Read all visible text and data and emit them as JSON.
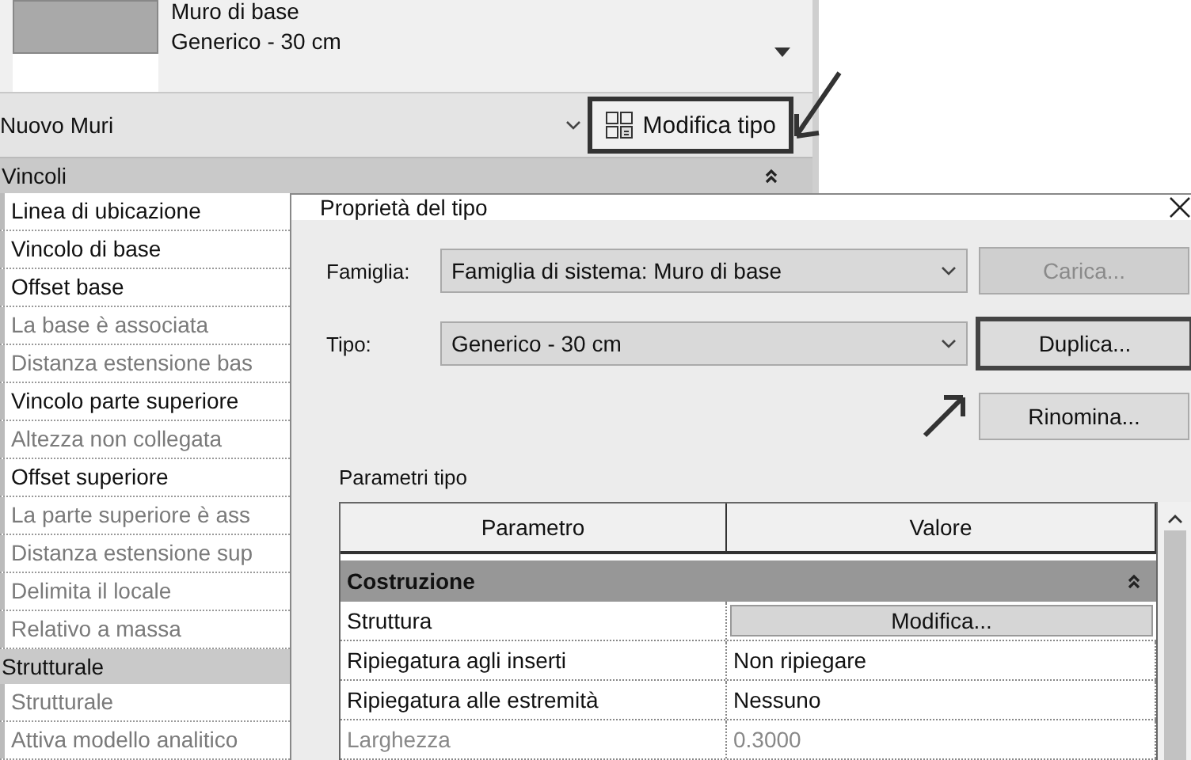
{
  "palette": {
    "type_selector": {
      "family": "Muro di base",
      "type": "Generico - 30 cm"
    },
    "instance_dropdown": "Nuovo Muri",
    "edit_type_button": {
      "label": "Modifica tipo",
      "highlighted": true
    },
    "groups": [
      {
        "label": "Vincoli",
        "expanded": true,
        "rows": [
          {
            "label": "Linea di ubicazione",
            "disabled": false
          },
          {
            "label": "Vincolo di base",
            "disabled": false
          },
          {
            "label": "Offset base",
            "disabled": false
          },
          {
            "label": "La base è associata",
            "disabled": true
          },
          {
            "label": "Distanza estensione bas",
            "disabled": true
          },
          {
            "label": "Vincolo parte superiore",
            "disabled": false
          },
          {
            "label": "Altezza non collegata",
            "disabled": true
          },
          {
            "label": "Offset superiore",
            "disabled": false
          },
          {
            "label": "La parte superiore è ass",
            "disabled": true
          },
          {
            "label": "Distanza estensione sup",
            "disabled": true
          },
          {
            "label": "Delimita il locale",
            "disabled": true
          },
          {
            "label": "Relativo a massa",
            "disabled": true
          }
        ]
      },
      {
        "label": "Strutturale",
        "rows": [
          {
            "label": "Strutturale",
            "disabled": true
          },
          {
            "label": "Attiva modello analitico",
            "disabled": true
          }
        ]
      }
    ]
  },
  "dialog": {
    "title": "Proprietà del tipo",
    "fields": [
      {
        "label": "Famiglia:",
        "value": "Famiglia di sistema: Muro di base"
      },
      {
        "label": "Tipo:",
        "value": "Generico - 30 cm"
      }
    ],
    "buttons": [
      {
        "label": "Carica...",
        "disabled": true,
        "highlighted": false
      },
      {
        "label": "Duplica...",
        "disabled": false,
        "highlighted": true
      },
      {
        "label": "Rinomina...",
        "disabled": false,
        "highlighted": false
      }
    ],
    "section_label": "Parametri tipo",
    "table": {
      "columns": [
        "Parametro",
        "Valore"
      ],
      "rows": [
        {
          "kind": "group",
          "label": "Costruzione"
        },
        {
          "kind": "button",
          "parameter": "Struttura",
          "value": "Modifica...",
          "disabled": false
        },
        {
          "kind": "value",
          "parameter": "Ripiegatura agli inserti",
          "value": "Non ripiegare",
          "disabled": false
        },
        {
          "kind": "value",
          "parameter": "Ripiegatura alle estremità",
          "value": "Nessuno",
          "disabled": false
        },
        {
          "kind": "value",
          "parameter": "Larghezza",
          "value": "0.3000",
          "disabled": true
        }
      ]
    }
  }
}
